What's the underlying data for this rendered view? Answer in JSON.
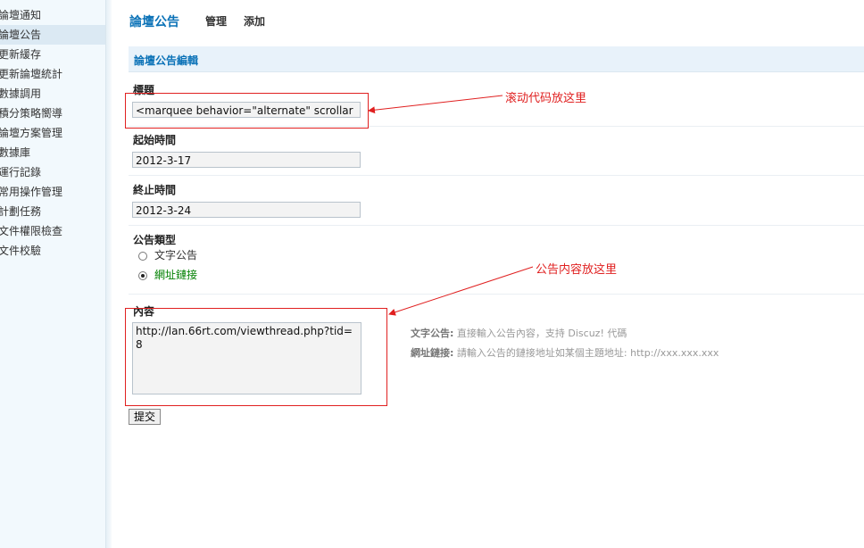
{
  "sidebar": {
    "items": [
      {
        "label": "論壇通知",
        "active": false
      },
      {
        "label": "論壇公告",
        "active": true
      },
      {
        "label": "更新緩存",
        "active": false
      },
      {
        "label": "更新論壇統計",
        "active": false
      },
      {
        "label": "數據調用",
        "active": false
      },
      {
        "label": "積分策略嚮導",
        "active": false
      },
      {
        "label": "論壇方案管理",
        "active": false
      },
      {
        "label": "數據庫",
        "active": false
      },
      {
        "label": "運行記錄",
        "active": false
      },
      {
        "label": "常用操作管理",
        "active": false
      },
      {
        "label": "計劃任務",
        "active": false
      },
      {
        "label": "文件權限檢查",
        "active": false
      },
      {
        "label": "文件校驗",
        "active": false
      }
    ]
  },
  "header": {
    "title": "論壇公告",
    "manage_label": "管理",
    "add_label": "添加"
  },
  "form": {
    "section_title": "論壇公告編輯",
    "title_label": "標題",
    "title_value": "<marquee behavior=\"alternate\" scrollar",
    "start_label": "起始時間",
    "start_value": "2012-3-17",
    "end_label": "終止時間",
    "end_value": "2012-3-24",
    "type_label": "公告類型",
    "type_options": [
      {
        "label": "文字公告",
        "checked": false,
        "color": "#333333"
      },
      {
        "label": "網址鏈接",
        "checked": true,
        "color": "#008000"
      }
    ],
    "content_label": "內容",
    "content_value": "http://lan.66rt.com/viewthread.php?tid=8",
    "help_text_label": "文字公告:",
    "help_text": "直接輸入公告內容，支持 Discuz! 代碼",
    "help_link_label": "網址鏈接:",
    "help_link": "請輸入公告的鏈接地址如某個主題地址: http://xxx.xxx.xxx",
    "submit_label": "提交"
  },
  "annotations": {
    "title_note": "滚动代码放这里",
    "content_note": "公告内容放这里",
    "color": "#e02020"
  }
}
